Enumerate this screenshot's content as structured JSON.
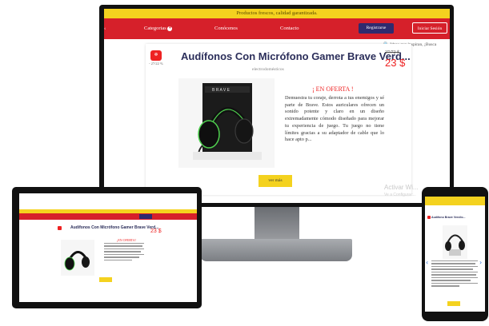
{
  "colors": {
    "brand_red": "#d6202a",
    "brand_yellow": "#f4d21f",
    "brand_navy": "#2b2e5a",
    "offer_red": "#e22222"
  },
  "desktop": {
    "topbar_text": "Productos frescos, calidad garantizada.",
    "nav": {
      "categories": "Categorias",
      "about": "Conócenos",
      "contact": "Contacto",
      "register": "Registrarse",
      "login": "Iniciar Sesión"
    },
    "search_hint": "Ideas que inspiran, ¡Busca",
    "badge_icon": "tag-icon",
    "badge_text": "-  27/22 %",
    "product": {
      "title": "Audífonos Con Micrófono Gamer Brave Verd...",
      "category": "electrodomésticos",
      "price_old": "27/72 $",
      "price_new": "23 $",
      "offer_label": "¡ EN OFERTA !",
      "description": "Demuestra tu coraje, derrota a tus enemigos y sé parte de Brave. Estos auriculares ofrecen un sonido potente y claro en un diseño extremadamente cómodo diseñado para mejorar tu experiencia de juego. Tu juego no tiene límites gracias a su adaptador de cable que lo hace apto p...",
      "view_more": "ver más"
    },
    "watermark_line1": "Activar Wi...",
    "watermark_line2": "Ve a Configurac..."
  },
  "tablet": {
    "title": "Audífonos Con Micrófono Gamer Brave Verd...",
    "offer_label": "¡EN OFERTA!",
    "price_new": "23 $"
  },
  "phone": {
    "title": "Audífono Brave Vercilo...",
    "chevron_left_icon": "chevron-left-icon",
    "chevron_right_icon": "chevron-right-icon"
  }
}
